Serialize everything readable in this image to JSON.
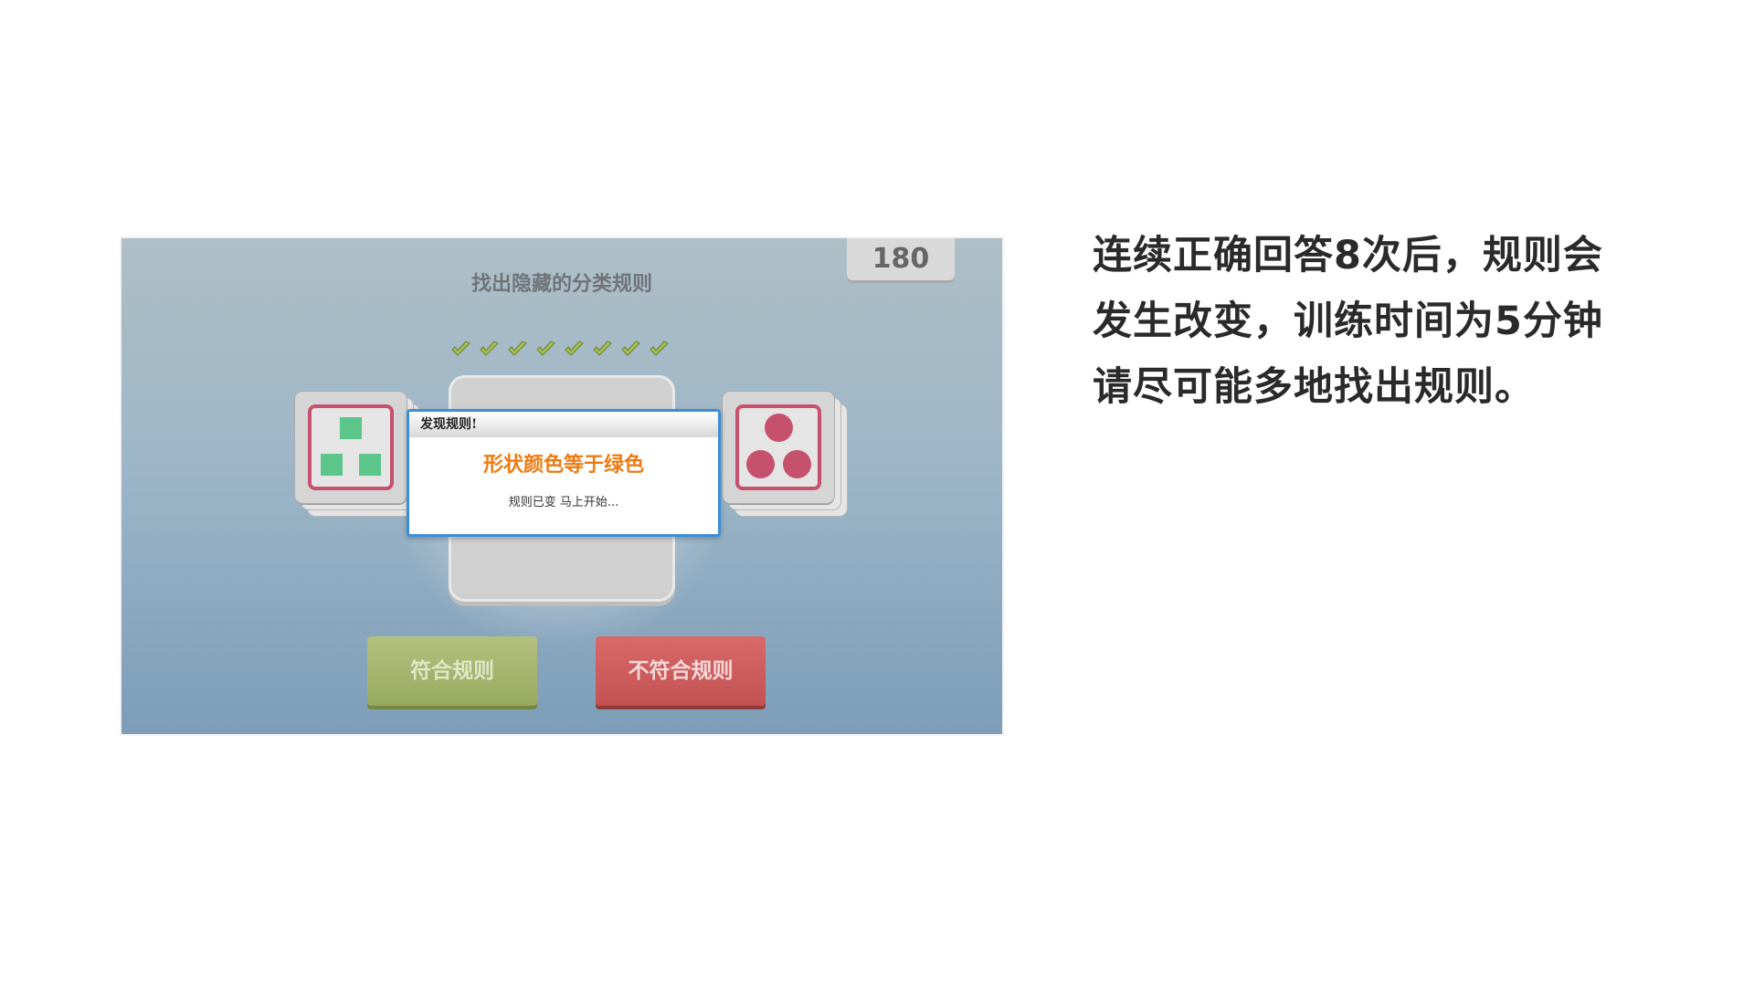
{
  "game": {
    "timer": "180",
    "title": "找出隐藏的分类规则",
    "correct_checks": 8,
    "colors": {
      "accent_orange": "#ef7a12",
      "dialog_border": "#3b8fd9",
      "shape_green": "#5cc68a",
      "shape_pink": "#c6516e",
      "btn_yes": "#a4b46c",
      "btn_no": "#cd5c5c"
    },
    "left_card": {
      "shape": "square",
      "count": 3,
      "color": "green"
    },
    "right_card": {
      "shape": "circle",
      "count": 3,
      "color": "pink"
    },
    "dialog": {
      "header": "发现规则!",
      "rule_text": "形状颜色等于绿色",
      "subtext": "规则已变 马上开始..."
    },
    "buttons": {
      "match": "符合规则",
      "no_match": "不符合规则"
    }
  },
  "caption": {
    "lines": [
      "连续正确回答8次后，规则会",
      "发生改变，训练时间为5分钟",
      "请尽可能多地找出规则。"
    ]
  }
}
